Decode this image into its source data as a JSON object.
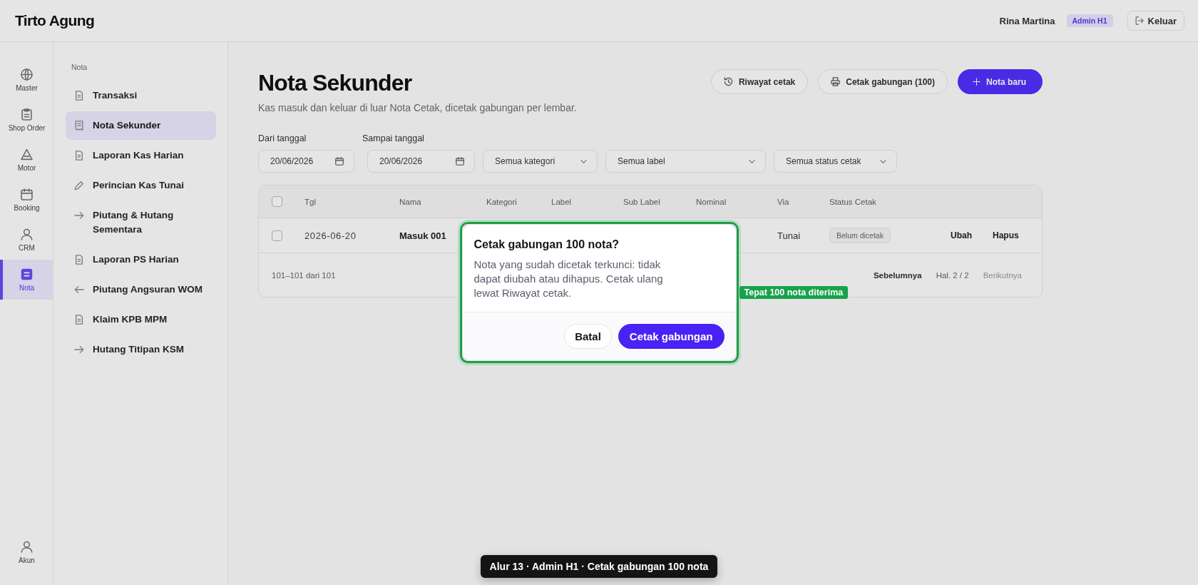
{
  "app": {
    "header": {
      "logo": "Tirto Agung",
      "user": "Rina Martina",
      "role": "Admin H1",
      "logout": "Keluar"
    },
    "rail": [
      {
        "label": "Master",
        "selected": false
      },
      {
        "label": "Shop Order",
        "selected": false
      },
      {
        "label": "Motor",
        "selected": false
      },
      {
        "label": "Booking",
        "selected": false
      },
      {
        "label": "CRM",
        "selected": false
      },
      {
        "label": "Nota",
        "selected": true
      }
    ],
    "account": {
      "label": "Akun"
    },
    "sidebar": {
      "section": "Nota",
      "items": [
        {
          "label": "Transaksi",
          "selected": false
        },
        {
          "label": "Nota Sekunder",
          "selected": true
        },
        {
          "label": "Laporan Kas Harian",
          "selected": false
        },
        {
          "label": "Perincian Kas Tunai",
          "selected": false
        },
        {
          "label": "Piutang & Hutang Sementara",
          "selected": false
        },
        {
          "label": "Laporan PS Harian",
          "selected": false
        },
        {
          "label": "Piutang Angsuran WOM",
          "selected": false
        },
        {
          "label": "Klaim KPB MPM",
          "selected": false
        },
        {
          "label": "Hutang Titipan KSM",
          "selected": false
        }
      ]
    },
    "page": {
      "title": "Nota Sekunder",
      "subtitle": "Kas masuk dan keluar di luar Nota Cetak, dicetak gabungan per lembar.",
      "actions": [
        {
          "label": "Riwayat cetak",
          "kind": "secondary"
        },
        {
          "label": "Cetak gabungan (100)",
          "kind": "secondary"
        },
        {
          "label": "Nota baru",
          "kind": "primary"
        }
      ],
      "filters": [
        {
          "kind": "date",
          "label": "Dari tanggal",
          "value": "20/06/2026"
        },
        {
          "kind": "date",
          "label": "Sampai tanggal",
          "value": "20/06/2026"
        },
        {
          "kind": "select",
          "value": "Semua kategori"
        },
        {
          "kind": "select",
          "value": "Semua label"
        },
        {
          "kind": "select",
          "value": "Semua status cetak"
        }
      ],
      "table": {
        "select_all": false,
        "columns": [
          "Tgl",
          "Nama",
          "Kategori",
          "Label",
          "Sub Label",
          "Nominal",
          "Via",
          "Status Cetak"
        ],
        "rows": [
          {
            "checked": false,
            "date": "2026-06-20",
            "name": "Masuk 001",
            "via": "Tunai",
            "status": "Belum dicetak",
            "actions": [
              "Ubah",
              "Hapus"
            ]
          }
        ],
        "footer": {
          "range": "101–101 dari 101",
          "prev": {
            "label": "Sebelumnya",
            "disabled": false
          },
          "page": "Hal. 2 / 2",
          "next": {
            "label": "Berikutnya",
            "disabled": true
          }
        }
      }
    }
  },
  "dialog": {
    "title": "Cetak gabungan 100 nota?",
    "message": "Nota yang sudah dicetak terkunci: tidak dapat diubah atau dihapus. Cetak ulang lewat Riwayat cetak.",
    "buttons": [
      {
        "label": "Batal",
        "kind": "secondary"
      },
      {
        "label": "Cetak gabungan",
        "kind": "primary"
      }
    ]
  },
  "highlight": {
    "label": "Tepat 100 nota diterima"
  },
  "caption": "Alur 13 · Admin H1 · Cetak gabungan 100 nota"
}
